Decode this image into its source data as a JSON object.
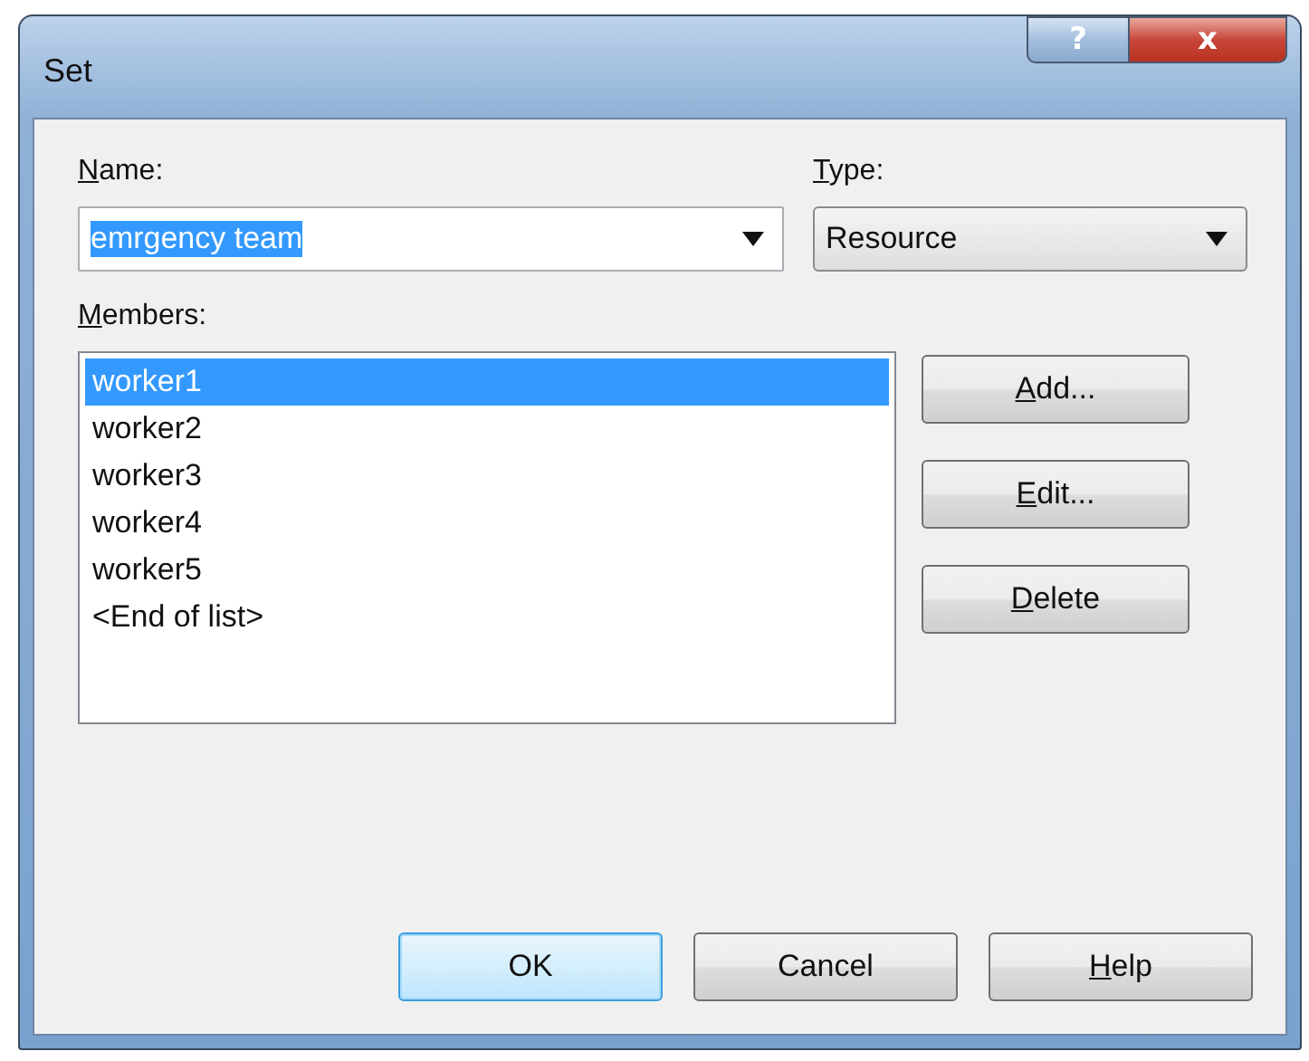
{
  "window": {
    "title": "Set",
    "help_button": "?",
    "close_button": "x"
  },
  "name": {
    "label": "Name:",
    "mnemonic": true,
    "value": "emrgency team",
    "value_selected": true
  },
  "type": {
    "label": "Type:",
    "mnemonic": true,
    "value": "Resource"
  },
  "members": {
    "label": "Members:",
    "mnemonic": true,
    "items": [
      {
        "text": "worker1",
        "selected": true
      },
      {
        "text": "worker2",
        "selected": false
      },
      {
        "text": "worker3",
        "selected": false
      },
      {
        "text": "worker4",
        "selected": false
      },
      {
        "text": "worker5",
        "selected": false
      },
      {
        "text": "<End of list>",
        "selected": false
      }
    ]
  },
  "side_buttons": [
    {
      "label": "Add...",
      "mnemonic": true
    },
    {
      "label": "Edit...",
      "mnemonic": true
    },
    {
      "label": "Delete",
      "mnemonic": true
    }
  ],
  "bottom_buttons": [
    {
      "label": "OK",
      "mnemonic": false,
      "default": true
    },
    {
      "label": "Cancel",
      "mnemonic": false,
      "default": false
    },
    {
      "label": "Help",
      "mnemonic": true,
      "default": false
    }
  ]
}
